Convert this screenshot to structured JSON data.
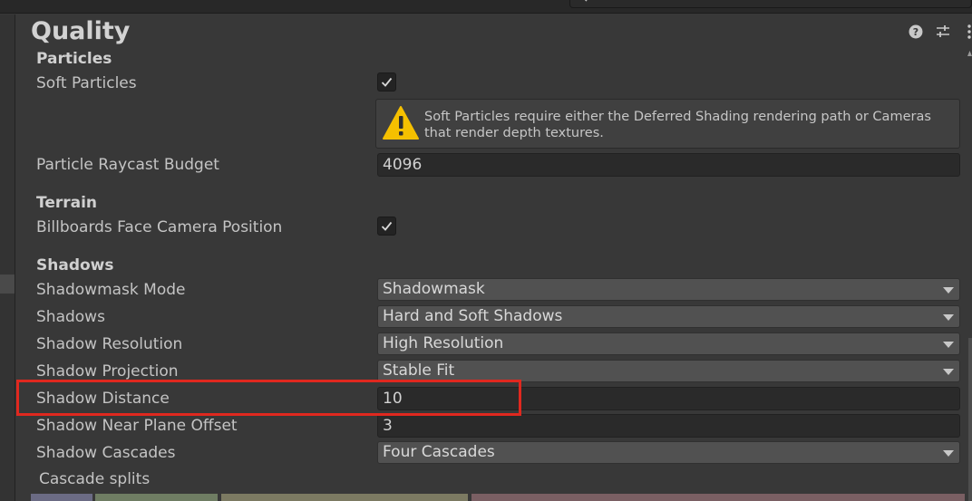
{
  "header": {
    "title": "Quality"
  },
  "icons": {
    "search": "search-icon",
    "help": "help-icon",
    "presets": "presets-icon",
    "more": "more-icon",
    "warning": "warning-icon",
    "checkmark": "checkmark-icon",
    "dropdown_arrow": "chevron-down-icon"
  },
  "colors": {
    "panel_bg": "#383838",
    "highlight": "#e0281f",
    "warning_yellow": "#f5c000",
    "cascade_1": "#6b6b84",
    "cascade_2": "#6f7d63",
    "cascade_3": "#7c7a62",
    "cascade_4": "#7a5f63"
  },
  "particles": {
    "section_title": "Particles",
    "soft_particles_label": "Soft Particles",
    "soft_particles_checked": true,
    "warning_text": "Soft Particles require either the Deferred Shading rendering path or Cameras that render depth textures.",
    "raycast_budget_label": "Particle Raycast Budget",
    "raycast_budget_value": "4096"
  },
  "terrain": {
    "section_title": "Terrain",
    "billboards_label": "Billboards Face Camera Position",
    "billboards_checked": true
  },
  "shadows": {
    "section_title": "Shadows",
    "shadowmask_mode_label": "Shadowmask Mode",
    "shadowmask_mode_value": "Shadowmask",
    "shadows_label": "Shadows",
    "shadows_value": "Hard and Soft Shadows",
    "resolution_label": "Shadow Resolution",
    "resolution_value": "High Resolution",
    "projection_label": "Shadow Projection",
    "projection_value": "Stable Fit",
    "distance_label": "Shadow Distance",
    "distance_value": "10",
    "near_plane_label": "Shadow Near Plane Offset",
    "near_plane_value": "3",
    "cascades_label": "Shadow Cascades",
    "cascades_value": "Four Cascades",
    "cascade_splits_label": "Cascade splits"
  }
}
